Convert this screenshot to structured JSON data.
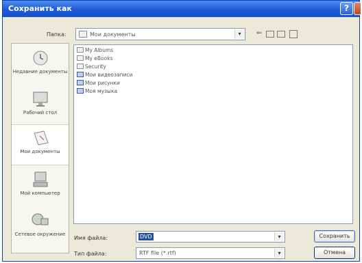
{
  "dialog": {
    "title": "Сохранить как",
    "help_label": "?"
  },
  "folder_row": {
    "label": "Папка:",
    "value": "Мои документы"
  },
  "places": [
    {
      "label": "Недавние документы",
      "icon": "recent-documents-icon"
    },
    {
      "label": "Рабочий стол",
      "icon": "desktop-icon"
    },
    {
      "label": "Мои документы",
      "icon": "my-documents-icon"
    },
    {
      "label": "Мой компьютер",
      "icon": "my-computer-icon"
    },
    {
      "label": "Сетевое окружение",
      "icon": "network-icon"
    }
  ],
  "files": [
    {
      "name": "My Albums",
      "type": "folder"
    },
    {
      "name": "My eBooks",
      "type": "folder"
    },
    {
      "name": "Security",
      "type": "folder"
    },
    {
      "name": "Мои видеозаписи",
      "type": "special"
    },
    {
      "name": "Мои рисунки",
      "type": "special"
    },
    {
      "name": "Моя музыка",
      "type": "special"
    }
  ],
  "filename": {
    "label": "Имя файла:",
    "value": "DVD"
  },
  "filetype": {
    "label": "Тип файла:",
    "value": "RTF file (*.rtf)"
  },
  "buttons": {
    "save": "Сохранить",
    "cancel": "Отмена"
  }
}
